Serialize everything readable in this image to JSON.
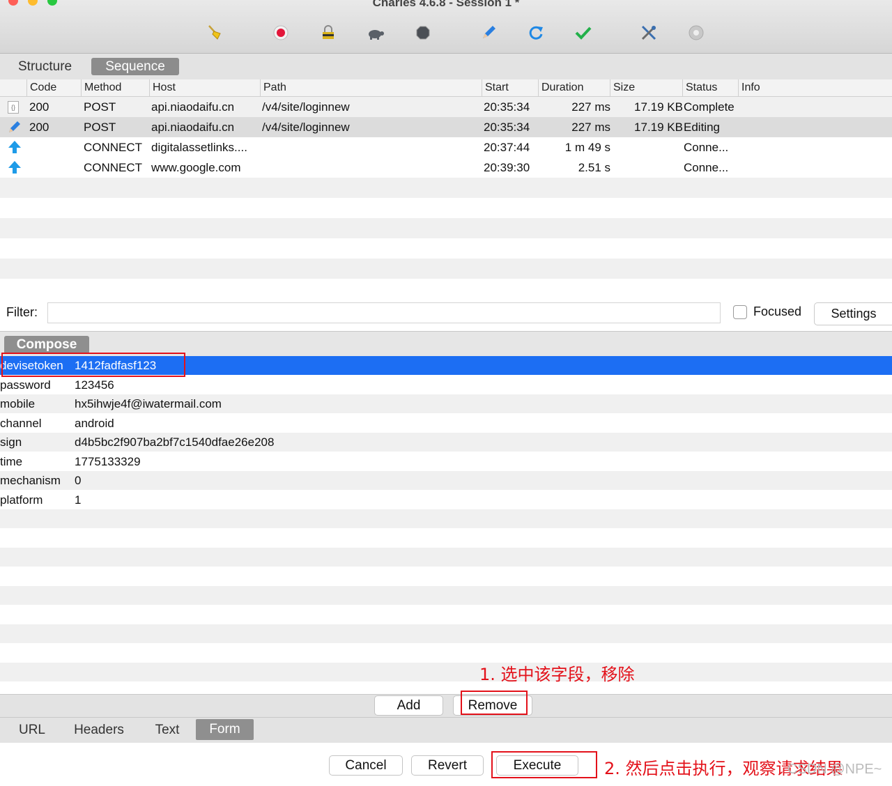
{
  "window": {
    "title": "Charles 4.6.8 - Session 1 *"
  },
  "toolbar": {
    "icons": [
      "broom-icon",
      "record-icon",
      "ssl-proxying-icon",
      "throttle-icon",
      "breakpoints-icon",
      "compose-icon",
      "repeat-icon",
      "validate-icon",
      "tools-icon",
      "settings-icon"
    ]
  },
  "view_tabs": {
    "structure": "Structure",
    "sequence": "Sequence"
  },
  "session": {
    "columns": [
      "Code",
      "Method",
      "Host",
      "Path",
      "Start",
      "Duration",
      "Size",
      "Status",
      "Info"
    ],
    "rows": [
      {
        "icon": "json-file-icon",
        "code": "200",
        "method": "POST",
        "host": "api.niaodaifu.cn",
        "path": "/v4/site/loginnew",
        "start": "20:35:34",
        "duration": "227 ms",
        "size": "17.19 KB",
        "status": "Complete",
        "info": ""
      },
      {
        "icon": "compose-edit-icon",
        "code": "200",
        "method": "POST",
        "host": "api.niaodaifu.cn",
        "path": "/v4/site/loginnew",
        "start": "20:35:34",
        "duration": "227 ms",
        "size": "17.19 KB",
        "status": "Editing",
        "info": ""
      },
      {
        "icon": "upload-arrow-icon",
        "code": "",
        "method": "CONNECT",
        "host": "digitalassetlinks....",
        "path": "",
        "start": "20:37:44",
        "duration": "1 m 49 s",
        "size": "",
        "status": "Conne...",
        "info": ""
      },
      {
        "icon": "upload-arrow-icon",
        "code": "",
        "method": "CONNECT",
        "host": "www.google.com",
        "path": "",
        "start": "20:39:30",
        "duration": "2.51 s",
        "size": "",
        "status": "Conne...",
        "info": ""
      }
    ]
  },
  "filter": {
    "label": "Filter:",
    "value": "",
    "focused_label": "Focused",
    "focused_checked": false,
    "settings_label": "Settings"
  },
  "compose": {
    "tab_label": "Compose",
    "fields": [
      {
        "name": "devisetoken",
        "value": "1412fadfasf123"
      },
      {
        "name": "password",
        "value": "123456"
      },
      {
        "name": "mobile",
        "value": "hx5ihwje4f@iwatermail.com"
      },
      {
        "name": "channel",
        "value": "android"
      },
      {
        "name": "sign",
        "value": "d4b5bc2f907ba2bf7c1540dfae26e208"
      },
      {
        "name": "time",
        "value": "1775133329"
      },
      {
        "name": "mechanism",
        "value": "0"
      },
      {
        "name": "platform",
        "value": "1"
      }
    ],
    "selected_index": 0,
    "add_label": "Add",
    "remove_label": "Remove"
  },
  "bottom_tabs": [
    "URL",
    "Headers",
    "Text",
    "Form"
  ],
  "active_bottom_tab": "Form",
  "actions": {
    "cancel": "Cancel",
    "revert": "Revert",
    "execute": "Execute"
  },
  "annotations": {
    "step1": "1. 选中该字段，移除",
    "step2": "2. 然后点击执行，观察请求结果"
  },
  "watermark": "CSDN @NPE~",
  "colors": {
    "selection": "#1c6ef3",
    "annotation_red": "#e3111a",
    "tab_active": "#8f8f8f"
  }
}
